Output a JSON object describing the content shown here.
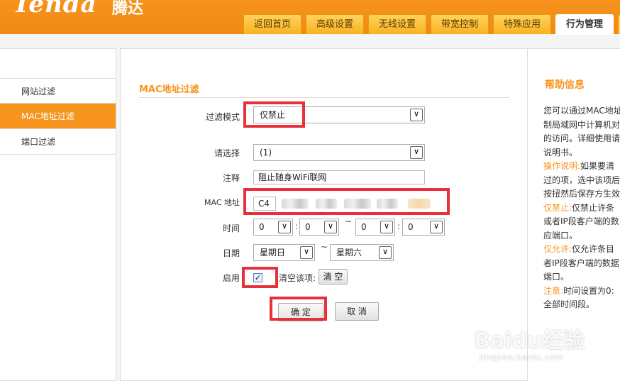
{
  "header": {
    "logo": "Tenda",
    "logo_cn": "腾达",
    "tabs": [
      {
        "label": "返回首页"
      },
      {
        "label": "高级设置"
      },
      {
        "label": "无线设置"
      },
      {
        "label": "带宽控制"
      },
      {
        "label": "特殊应用"
      },
      {
        "label": "行为管理",
        "active": true
      }
    ]
  },
  "sidebar": {
    "items": [
      {
        "label": "网站过滤"
      },
      {
        "label": "MAC地址过滤",
        "active": true
      },
      {
        "label": "端口过滤"
      }
    ]
  },
  "form": {
    "section_title": "MAC地址过滤",
    "filter_mode_label": "过滤模式",
    "filter_mode_value": "仅禁止",
    "select_label": "请选择",
    "select_value": "(1)",
    "note_label": "注释",
    "note_value": "阻止随身WiFi联网",
    "mac_label": "MAC 地址",
    "mac_first_octet": "C4",
    "time_label": "时间",
    "time_values": [
      "0",
      "0",
      "0",
      "0"
    ],
    "time_sep": "~",
    "time_colon": ":",
    "date_label": "日期",
    "date_start": "星期日",
    "date_end": "星期六",
    "date_sep": "~",
    "enable_label": "启用",
    "enable_checked": true,
    "enable_check_glyph": "✓",
    "clear_item_label": "清空该项:",
    "clear_button": "清 空",
    "ok_button": "确 定",
    "cancel_button": "取 消",
    "dropdown_glyph": "∨"
  },
  "help": {
    "title": "帮助信息",
    "lines": [
      {
        "text": "您可以通过MAC地址过",
        "hl": false
      },
      {
        "text": "制局域网中计算机对",
        "hl": false
      },
      {
        "text": "的访问。详细使用请",
        "hl": false
      },
      {
        "text": "说明书。",
        "hl": false
      },
      {
        "hl_text": "操作说明:",
        "text": "如果要清",
        "hl": true
      },
      {
        "text": "过的项，选中该项后",
        "hl": false
      },
      {
        "text": "按扭然后保存方生效",
        "hl": false
      },
      {
        "hl_text": "仅禁止:",
        "text": "仅禁止许条",
        "hl": true
      },
      {
        "text": "或者IP段客户端的数",
        "hl": false
      },
      {
        "text": "应端口。",
        "hl": false
      },
      {
        "hl_text": "仅允许:",
        "text": "仅允许条目",
        "hl": true
      },
      {
        "text": "者IP段客户端的数据",
        "hl": false
      },
      {
        "text": "端口。",
        "hl": false
      },
      {
        "hl_text": "注意:",
        "text": "时间设置为0:",
        "hl": true
      },
      {
        "text": "全部时间段。",
        "hl": false
      }
    ]
  },
  "watermark": {
    "brand": "Baidu经验",
    "url": "jingyan.baidu.com"
  },
  "colors": {
    "brand_orange": "#f7941d",
    "highlight_red": "#e8303a"
  }
}
